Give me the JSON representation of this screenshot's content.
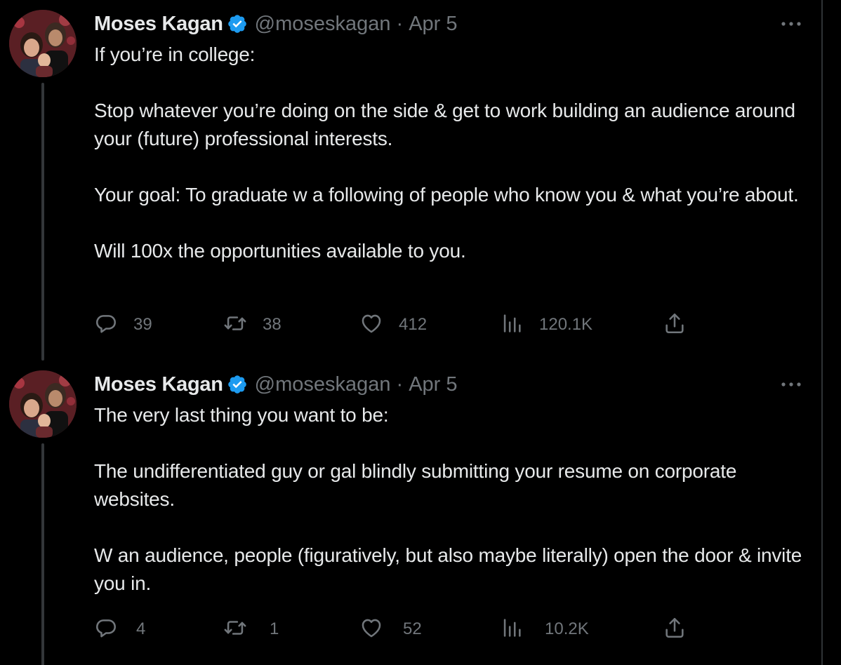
{
  "tweets": [
    {
      "author": {
        "name": "Moses Kagan",
        "handle": "@moseskagan",
        "verified": true
      },
      "separator": "·",
      "date": "Apr 5",
      "paragraphs": [
        "If you’re in college:",
        "Stop whatever you’re doing on the side & get to work building an audience around your (future) professional interests.",
        "Your goal: To graduate w a following of people who know you & what you’re about.",
        "Will 100x the opportunities available to you."
      ],
      "metrics": {
        "replies": "39",
        "retweets": "38",
        "likes": "412",
        "views": "120.1K"
      }
    },
    {
      "author": {
        "name": "Moses Kagan",
        "handle": "@moseskagan",
        "verified": true
      },
      "separator": "·",
      "date": "Apr 5",
      "paragraphs": [
        "The very last thing you want to be:",
        "The undifferentiated guy or gal blindly submitting your resume on corporate websites.",
        "W an audience, people (figuratively, but also maybe literally) open the door & invite you in."
      ],
      "metrics": {
        "replies": "4",
        "retweets": "1",
        "likes": "52",
        "views": "10.2K"
      }
    }
  ],
  "icons": {
    "verified": "verified-badge-icon",
    "more": "more-options-icon",
    "reply": "reply-icon",
    "retweet": "retweet-icon",
    "like": "heart-icon",
    "views": "views-icon",
    "share": "share-icon"
  },
  "colors": {
    "background": "#000000",
    "text": "#e7e9ea",
    "muted": "#71767b",
    "verified": "#1d9bf0",
    "thread_line": "#333639"
  }
}
